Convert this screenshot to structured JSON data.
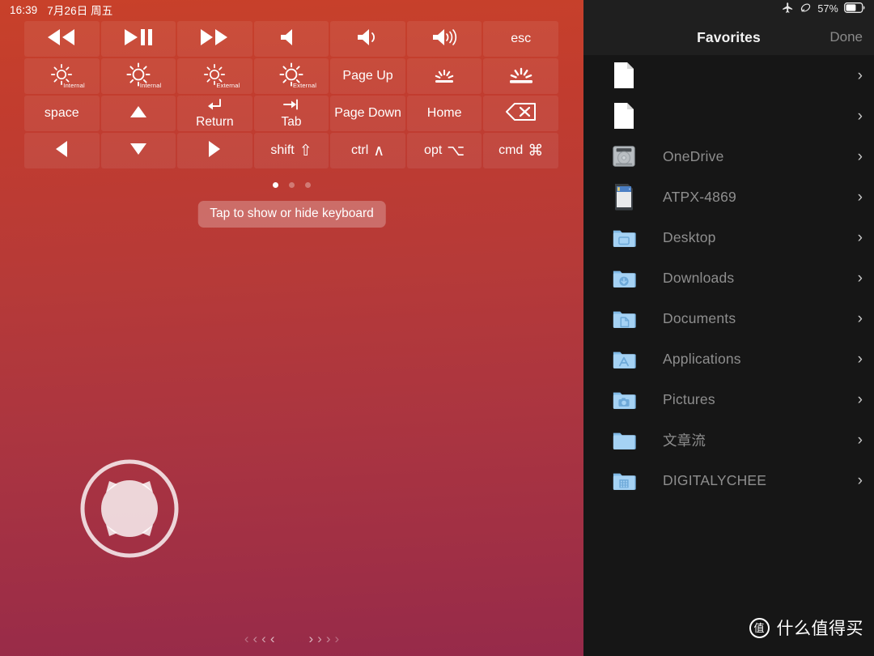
{
  "status_left": {
    "time": "16:39",
    "date": "7月26日 周五"
  },
  "status_right": {
    "airplane_icon": "airplane-mode-icon",
    "rotation_lock_icon": "rotation-lock-icon",
    "battery_percent": "57%",
    "battery_icon": "battery-icon"
  },
  "keypad": {
    "rows": [
      [
        {
          "name": "rewind",
          "icon": "rewind-icon",
          "label": ""
        },
        {
          "name": "play-pause",
          "icon": "play-pause-icon",
          "label": ""
        },
        {
          "name": "fast-forward",
          "icon": "fast-forward-icon",
          "label": ""
        },
        {
          "name": "mute",
          "icon": "volume-mute-icon",
          "label": ""
        },
        {
          "name": "volume-down",
          "icon": "volume-down-icon",
          "label": ""
        },
        {
          "name": "volume-up",
          "icon": "volume-up-icon",
          "label": ""
        },
        {
          "name": "esc",
          "icon": "",
          "label": "esc"
        }
      ],
      [
        {
          "name": "brightness-down-internal",
          "icon": "brightness-down-icon",
          "label": "",
          "tag": "Internal"
        },
        {
          "name": "brightness-up-internal",
          "icon": "brightness-up-icon",
          "label": "",
          "tag": "Internal"
        },
        {
          "name": "brightness-down-external",
          "icon": "brightness-down-icon",
          "label": "",
          "tag": "External"
        },
        {
          "name": "brightness-up-external",
          "icon": "brightness-up-icon",
          "label": "",
          "tag": "External"
        },
        {
          "name": "page-up",
          "icon": "",
          "label": "Page Up"
        },
        {
          "name": "keyboard-backlight-down",
          "icon": "keyboard-backlight-down-icon",
          "label": ""
        },
        {
          "name": "keyboard-backlight-up",
          "icon": "keyboard-backlight-up-icon",
          "label": ""
        }
      ],
      [
        {
          "name": "space",
          "icon": "",
          "label": "space"
        },
        {
          "name": "arrow-up",
          "icon": "arrow-up-icon",
          "label": ""
        },
        {
          "name": "return",
          "icon": "return-arrow-icon",
          "label": "Return"
        },
        {
          "name": "tab",
          "icon": "tab-arrow-icon",
          "label": "Tab"
        },
        {
          "name": "page-down",
          "icon": "",
          "label": "Page Down"
        },
        {
          "name": "home",
          "icon": "",
          "label": "Home"
        },
        {
          "name": "delete",
          "icon": "delete-backspace-icon",
          "label": ""
        }
      ],
      [
        {
          "name": "arrow-left",
          "icon": "arrow-left-icon",
          "label": ""
        },
        {
          "name": "arrow-down",
          "icon": "arrow-down-icon",
          "label": ""
        },
        {
          "name": "arrow-right",
          "icon": "arrow-right-icon",
          "label": ""
        },
        {
          "name": "shift",
          "icon": "",
          "label": "shift",
          "modsym": "⇧"
        },
        {
          "name": "ctrl",
          "icon": "",
          "label": "ctrl",
          "modsym": "∧"
        },
        {
          "name": "opt",
          "icon": "",
          "label": "opt",
          "modsym": "⌥"
        },
        {
          "name": "cmd",
          "icon": "",
          "label": "cmd",
          "modsym": "⌘"
        }
      ]
    ]
  },
  "pager": {
    "total": 3,
    "active_index": 0
  },
  "hint": {
    "text": "Tap to show or hide keyboard"
  },
  "joystick": {
    "name": "directional-pad"
  },
  "bottom_nav": {
    "left_chevron": "‹",
    "right_chevron": "›",
    "count": 4
  },
  "panel": {
    "title": "Favorites",
    "done_label": "Done",
    "items": [
      {
        "label": "",
        "icon": "document-icon",
        "chevron": "›"
      },
      {
        "label": "",
        "icon": "document-icon",
        "chevron": "›"
      },
      {
        "label": "OneDrive",
        "icon": "hard-drive-icon",
        "chevron": "›"
      },
      {
        "label": "ATPX-4869",
        "icon": "removable-disk-icon",
        "chevron": "›"
      },
      {
        "label": "Desktop",
        "icon": "folder-desktop-icon",
        "chevron": "›"
      },
      {
        "label": "Downloads",
        "icon": "folder-downloads-icon",
        "chevron": "›"
      },
      {
        "label": "Documents",
        "icon": "folder-documents-icon",
        "chevron": "›"
      },
      {
        "label": "Applications",
        "icon": "folder-applications-icon",
        "chevron": "›"
      },
      {
        "label": "Pictures",
        "icon": "folder-pictures-icon",
        "chevron": "›"
      },
      {
        "label": "文章流",
        "icon": "folder-plain-icon",
        "chevron": "›"
      },
      {
        "label": "DIGITALYCHEE",
        "icon": "folder-server-icon",
        "chevron": "›"
      }
    ]
  },
  "watermark": {
    "logo_text": "值",
    "text": "什么值得买"
  },
  "colors": {
    "gradient_top": "#c8412a",
    "gradient_bottom": "#962a4a",
    "panel_bg": "#161616",
    "panel_header_bg": "#1f1f1f",
    "folder_blue": "#8dc6ef",
    "item_text": "#8e8e8e"
  }
}
